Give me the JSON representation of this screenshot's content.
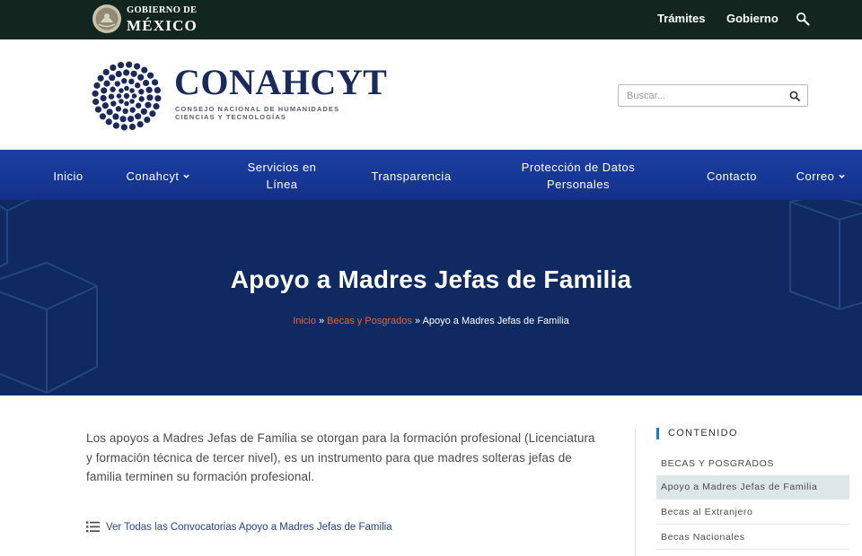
{
  "gov_bar": {
    "line1": "GOBIERNO DE",
    "line2": "MÉXICO",
    "links": [
      "Trámites",
      "Gobierno"
    ],
    "search_icon": "magnifier-icon"
  },
  "header": {
    "logo_name": "CONAHCYT",
    "logo_sub_1": "CONSEJO NACIONAL DE HUMANIDADES",
    "logo_sub_2": "CIENCIAS Y TECNOLOGÍAS",
    "search_placeholder": "Buscar..."
  },
  "nav": {
    "items": [
      {
        "label": "Inicio"
      },
      {
        "label": "Conahcyt",
        "dropdown": true
      },
      {
        "label_1": "Servicios en",
        "label_2": "Línea"
      },
      {
        "label": "Transparencia"
      },
      {
        "label_1": "Protección de Datos",
        "label_2": "Personales"
      },
      {
        "label": "Contacto"
      },
      {
        "label": "Correo",
        "dropdown": true
      }
    ]
  },
  "hero": {
    "title": "Apoyo a Madres Jefas de Familia",
    "breadcrumb": [
      "Inicio",
      "Becas y Posgrados",
      "Apoyo a Madres Jefas de Familia"
    ],
    "separator": "»"
  },
  "content": {
    "intro": "Los apoyos a Madres Jefas de Familia se otorgan para la formación profesional (Licenciatura y formación técnica de tercer nivel), es un instrumento para que madres solteras jefas de familia terminen su formación profesional.",
    "view_all_prefix": "Ver Todas las",
    "view_all_link": "Convocatorias Apoyo a Madres Jefas de Familia"
  },
  "sidebar": {
    "title": "CONTENIDO",
    "items": [
      {
        "label": "BECAS Y POSGRADOS"
      },
      {
        "label": "Apoyo a Madres Jefas de Familia",
        "active": true
      },
      {
        "label": "Becas al Extranjero"
      },
      {
        "label": "Becas Nacionales"
      }
    ]
  },
  "colors": {
    "gov_bar": "#12251e",
    "brand_navy": "#1a2a5c",
    "nav_blue": "#13318a",
    "hero_bg": "#0e2a60",
    "breadcrumb_link": "#e8632f",
    "sidebar_accent": "#0e7fd6",
    "sidebar_active": "#dde7e8"
  }
}
